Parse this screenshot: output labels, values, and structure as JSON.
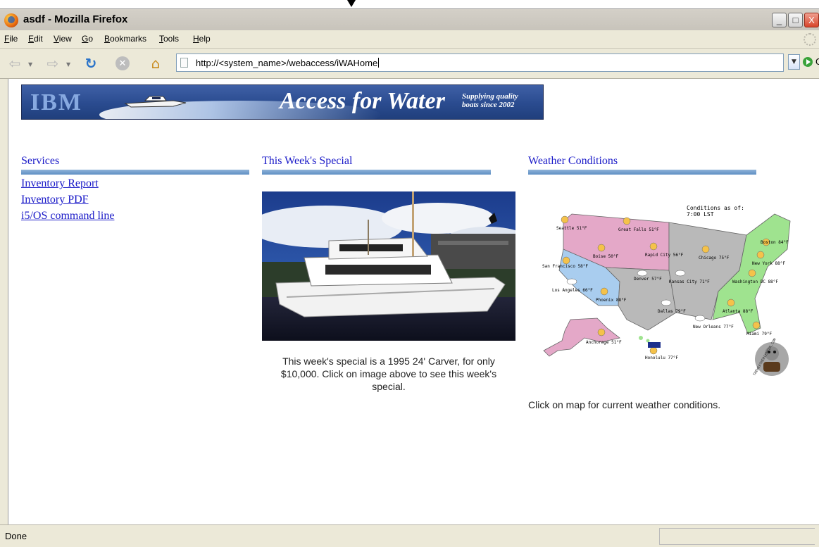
{
  "window": {
    "title": "asdf - Mozilla Firefox",
    "controls": {
      "minimize": "_",
      "maximize": "□",
      "close": "X"
    }
  },
  "menu": [
    {
      "label": "File",
      "accel": "F",
      "rest": "ile"
    },
    {
      "label": "Edit",
      "accel": "E",
      "rest": "dit"
    },
    {
      "label": "View",
      "accel": "V",
      "rest": "iew"
    },
    {
      "label": "Go",
      "accel": "G",
      "rest": "o"
    },
    {
      "label": "Bookmarks",
      "accel": "B",
      "rest": "ookmarks"
    },
    {
      "label": "Tools",
      "accel": "T",
      "rest": "ools"
    },
    {
      "label": "Help",
      "accel": "H",
      "rest": "elp"
    }
  ],
  "navigation": {
    "url": "http://<system_name>/webaccess/iWAHome",
    "go_label": "Go"
  },
  "banner": {
    "logo": "IBM",
    "title": "Access for Water",
    "tagline_line1": "Supplying quality",
    "tagline_line2": "boats since 2002"
  },
  "services": {
    "heading": "Services",
    "links": [
      "Inventory Report",
      "Inventory PDF",
      "i5/OS command line"
    ]
  },
  "special": {
    "heading": "This Week's Special",
    "caption_line1": "This week's special is a 1995 24' Carver, for only",
    "caption_line2": "$10,000.  Click on image above to see this week's",
    "caption_line3": "special."
  },
  "weather": {
    "heading": "Weather Conditions",
    "map_header_line1": "Conditions as of:",
    "map_header_line2": "7:00 LST",
    "cities": [
      {
        "name": "Seattle",
        "temp": "51°F"
      },
      {
        "name": "Great Falls",
        "temp": "51°F"
      },
      {
        "name": "Boise",
        "temp": "50°F"
      },
      {
        "name": "Rapid City",
        "temp": "56°F"
      },
      {
        "name": "Chicago",
        "temp": "75°F"
      },
      {
        "name": "Boston",
        "temp": "84°F"
      },
      {
        "name": "New York",
        "temp": "88°F"
      },
      {
        "name": "San Francisco",
        "temp": "58°F"
      },
      {
        "name": "Denver",
        "temp": "57°F"
      },
      {
        "name": "Kansas City",
        "temp": "71°F"
      },
      {
        "name": "Washington DC",
        "temp": "88°F"
      },
      {
        "name": "Los Angeles",
        "temp": "66°F"
      },
      {
        "name": "Phoenix",
        "temp": "88°F"
      },
      {
        "name": "Dallas",
        "temp": "79°F"
      },
      {
        "name": "Atlanta",
        "temp": "88°F"
      },
      {
        "name": "New Orleans",
        "temp": "77°F"
      },
      {
        "name": "Miami",
        "temp": "79°F"
      },
      {
        "name": "Anchorage",
        "temp": "51°F"
      },
      {
        "name": "Honolulu",
        "temp": "77°F"
      }
    ],
    "watermark": "THEWEATHERCENTER.COM",
    "caption": "Click on map for current weather conditions."
  },
  "status": {
    "text": "Done"
  },
  "colors": {
    "link": "#1a1ac8",
    "rule": "#6f9ccc",
    "banner": "#2a4b8f",
    "map_pink": "#e4a8c8",
    "map_blue": "#a9cdef",
    "map_green": "#9fe38f",
    "map_gray": "#b9b9b9"
  }
}
